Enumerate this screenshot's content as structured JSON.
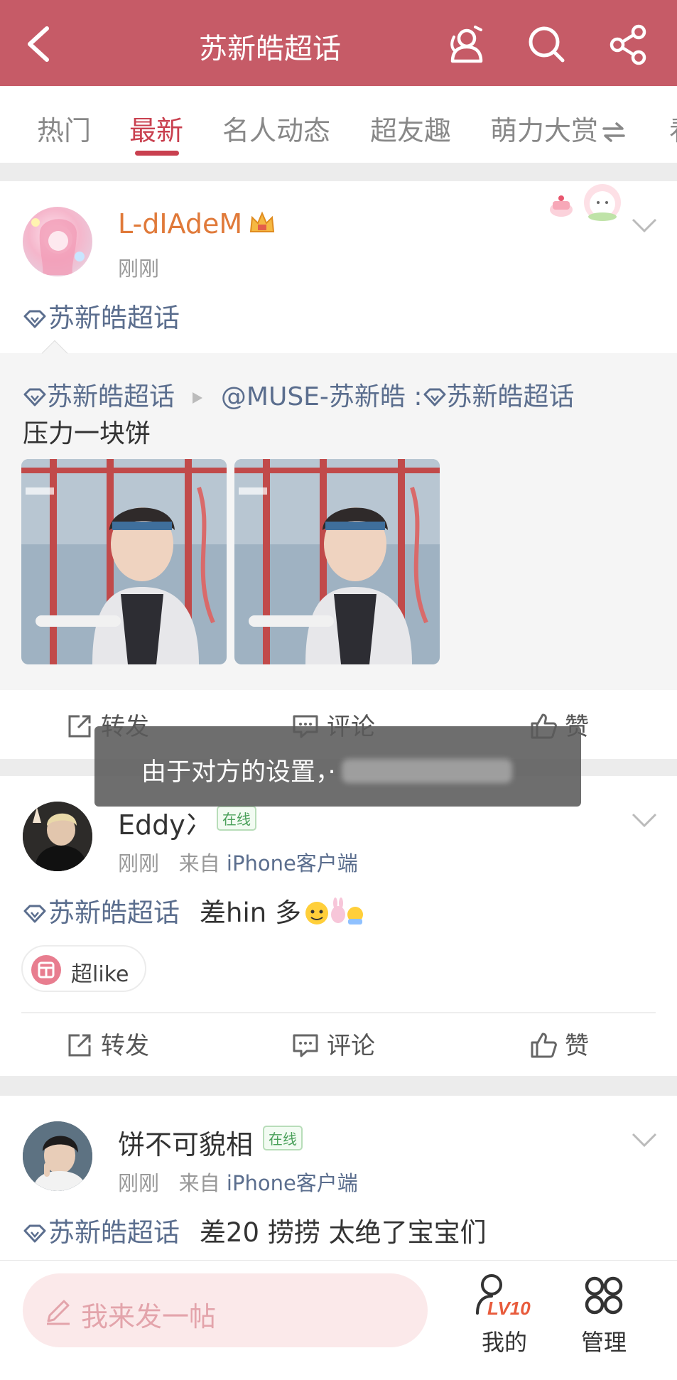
{
  "header": {
    "title": "苏新皓超话",
    "back_icon": "chevron-left-icon",
    "icons": [
      "user-follow-icon",
      "search-icon",
      "share-icon"
    ],
    "color": "#c65b67"
  },
  "tabs": [
    {
      "label": "热门",
      "active": false
    },
    {
      "label": "最新",
      "active": true
    },
    {
      "label": "名人动态",
      "active": false
    },
    {
      "label": "超友趣",
      "active": false
    },
    {
      "label": "萌力大赏",
      "active": false
    },
    {
      "label": "看",
      "active": false
    }
  ],
  "posts": [
    {
      "username": "L-dIAdeM",
      "time": "刚刚",
      "topic": "苏新皓超话",
      "repost": {
        "topic": "苏新皓超话",
        "mention": "@MUSE-苏新皓",
        "topic2": "苏新皓超话",
        "text": "压力一块饼"
      },
      "actions": {
        "repost": "转发",
        "comment": "评论",
        "like": "赞"
      }
    },
    {
      "username": "Eddy冫",
      "online": "在线",
      "time": "刚刚",
      "source_prefix": "来自",
      "source": "iPhone客户端",
      "topic": "苏新皓超话",
      "body": "差hin 多",
      "chip": "超like",
      "actions": {
        "repost": "转发",
        "comment": "评论",
        "like": "赞"
      }
    },
    {
      "username": "饼不可貌相",
      "online": "在线",
      "time": "刚刚",
      "source_prefix": "来自",
      "source": "iPhone客户端",
      "topic": "苏新皓超话",
      "body": "差20 捞捞 太绝了宝宝们"
    }
  ],
  "toast": {
    "text": "由于对方的设置，·"
  },
  "bottom": {
    "compose": "我来发一帖",
    "level": "LV10",
    "mine": "我的",
    "manage": "管理"
  }
}
